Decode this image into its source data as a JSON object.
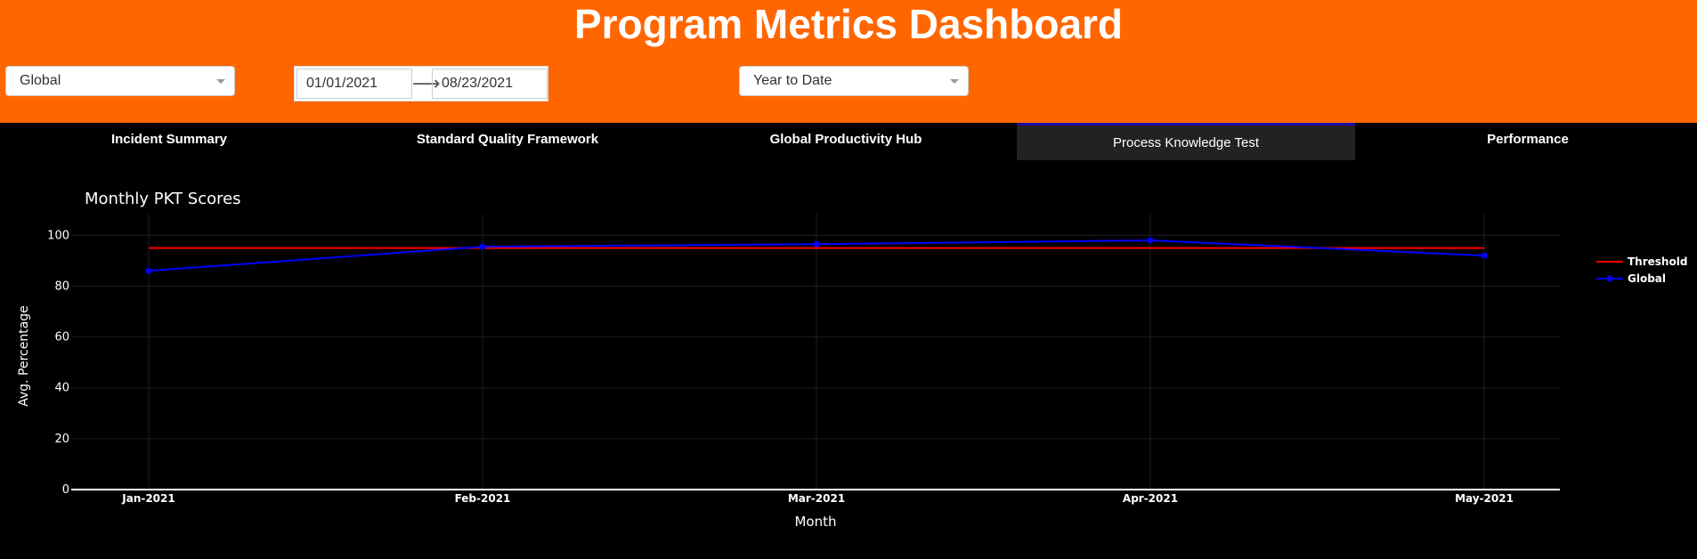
{
  "header": {
    "title": "Program Metrics Dashboard",
    "background_color": "#ff6600"
  },
  "filters": {
    "region": {
      "value": "Global",
      "icon": "chevron-down-icon"
    },
    "date_range": {
      "start": "01/01/2021",
      "arrow": "⟶",
      "end": "08/23/2021"
    },
    "period": {
      "value": "Year to Date",
      "icon": "chevron-down-icon"
    }
  },
  "tabs": [
    {
      "label": "Incident Summary",
      "active": false
    },
    {
      "label": "Standard Quality Framework",
      "active": false
    },
    {
      "label": "Global Productivity Hub",
      "active": false
    },
    {
      "label": "Process Knowledge Test",
      "active": true
    },
    {
      "label": "Performance",
      "active": false
    }
  ],
  "chart_data": {
    "type": "line",
    "title": "Monthly PKT Scores",
    "xlabel": "Month",
    "ylabel": "Avg. Percentage",
    "categories": [
      "Jan-2021",
      "Feb-2021",
      "Mar-2021",
      "Apr-2021",
      "May-2021"
    ],
    "ylim": [
      0,
      105
    ],
    "yticks": [
      0,
      20,
      40,
      60,
      80,
      100
    ],
    "grid": true,
    "legend_position": "top-right",
    "series": [
      {
        "name": "Threshold",
        "color": "#ff0000",
        "markers": false,
        "values": [
          95,
          95,
          95,
          95,
          95
        ]
      },
      {
        "name": "Global",
        "color": "#0000ff",
        "markers": true,
        "values": [
          86,
          95.5,
          96.5,
          98,
          92
        ]
      }
    ]
  }
}
